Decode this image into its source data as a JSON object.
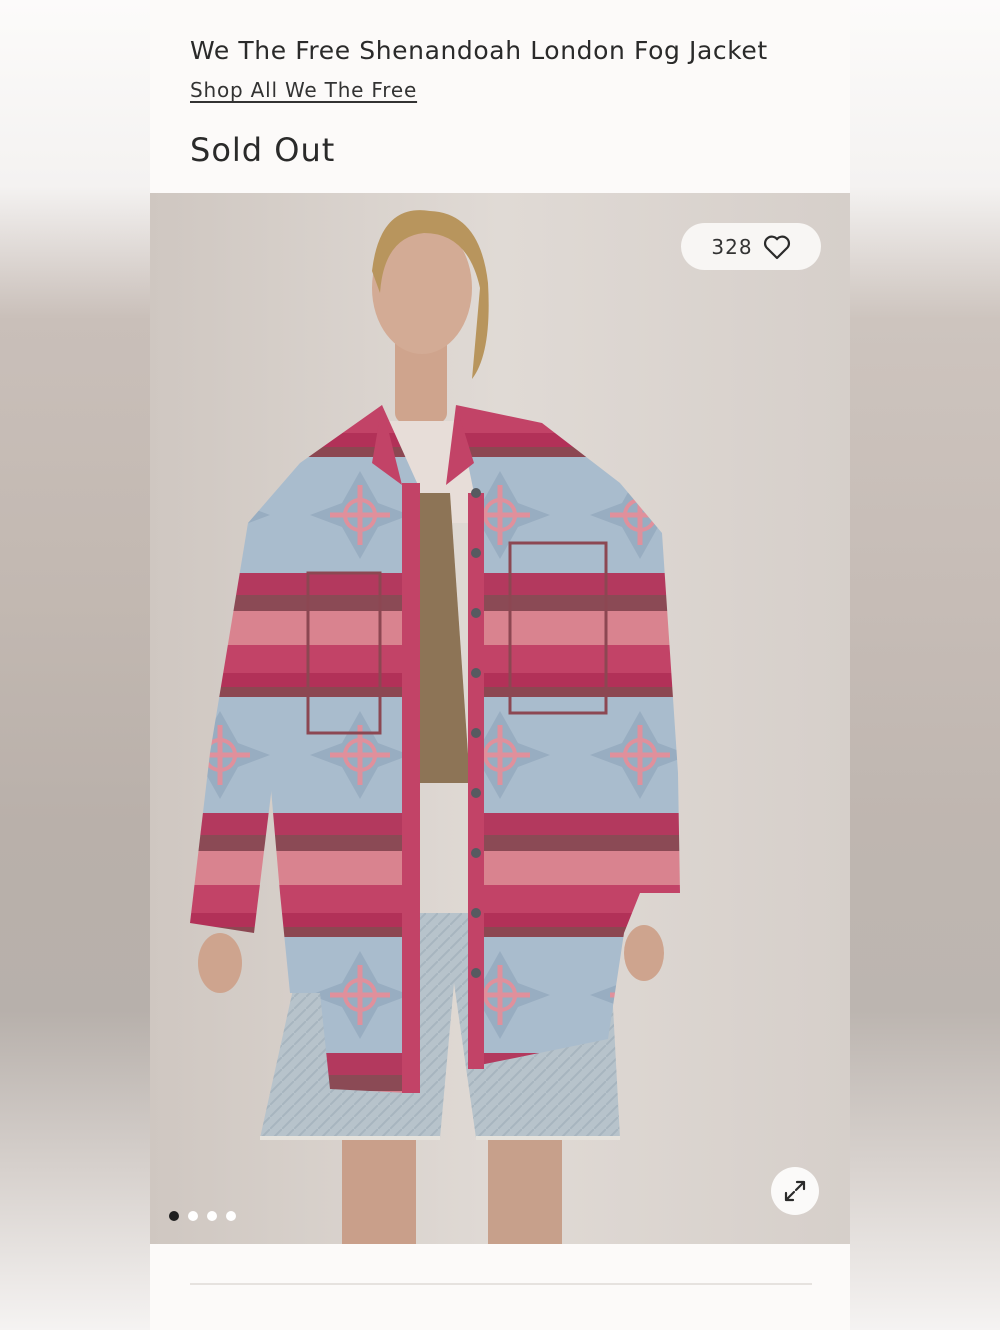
{
  "product": {
    "title": "We The Free Shenandoah London Fog Jacket",
    "brand_link": "Shop All We The Free",
    "status": "Sold Out"
  },
  "gallery": {
    "like_count": "328",
    "like_icon": "heart-outline",
    "expand_icon": "expand-arrows",
    "carousel": {
      "image_count": 4,
      "active_index": 0
    }
  },
  "colors": {
    "text": "#2a2a2a",
    "page_background": "#fcfaf9",
    "jacket_magenta": "#b23158",
    "jacket_pink": "#d8808f",
    "jacket_blue_grey": "#9fb1c4",
    "denim": "#b8c4cc"
  }
}
